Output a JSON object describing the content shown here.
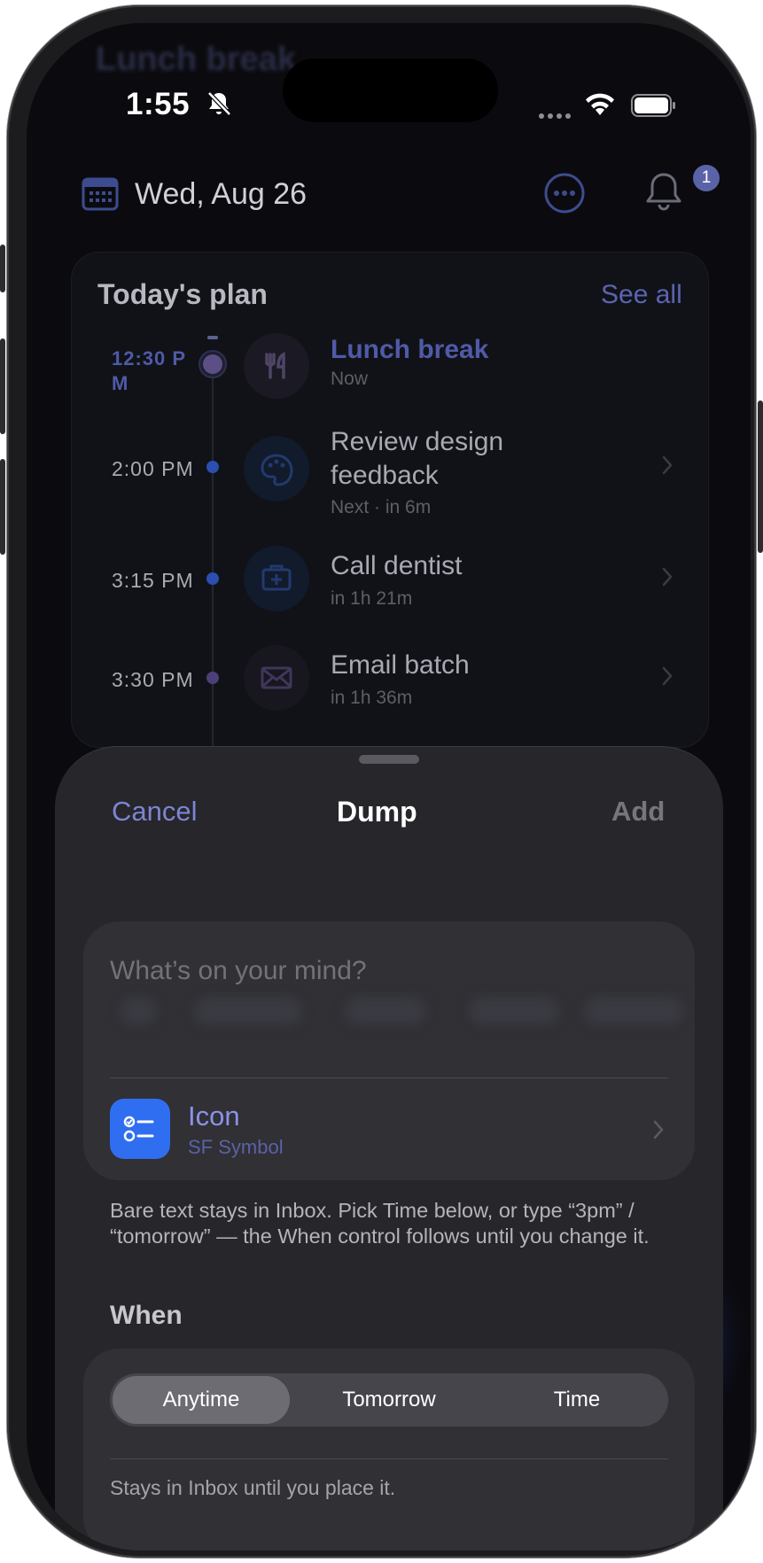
{
  "status_bar": {
    "time": "1:55"
  },
  "ghost_title": "Lunch break",
  "header": {
    "date": "Wed, Aug 26",
    "notification_count": "1"
  },
  "plan": {
    "title": "Today's plan",
    "see_all": "See all",
    "items": [
      {
        "time_line1": "12:30 P",
        "time_line2": "M",
        "title": "Lunch break",
        "subtitle": "Now",
        "icon": "fork-knife-icon",
        "current": true
      },
      {
        "time": "2:00 PM",
        "title_line1": "Review design",
        "title_line2": "feedback",
        "subtitle": "Next · in 6m",
        "icon": "palette-icon"
      },
      {
        "time": "3:15 PM",
        "title": "Call dentist",
        "subtitle": "in 1h 21m",
        "icon": "medical-bag-icon"
      },
      {
        "time": "3:30 PM",
        "title": "Email batch",
        "subtitle": "in 1h 36m",
        "icon": "envelope-icon"
      }
    ]
  },
  "sheet": {
    "cancel": "Cancel",
    "title": "Dump",
    "add": "Add",
    "input_placeholder": "What’s on your mind?",
    "icon_row": {
      "label": "Icon",
      "sublabel": "SF Symbol",
      "icon": "checklist-icon"
    },
    "hint": "Bare text stays in Inbox. Pick Time below, or type “3pm” / “tomorrow” — the When control follows until you change it.",
    "when_title": "When",
    "when_options": [
      "Anytime",
      "Tomorrow",
      "Time"
    ],
    "when_selected": "Anytime",
    "when_note": "Stays in Inbox until you place it."
  },
  "colors": {
    "accent": "#7d84d2",
    "icon_tile": "#2f6ef0",
    "sheet_bg": "#26262b"
  }
}
